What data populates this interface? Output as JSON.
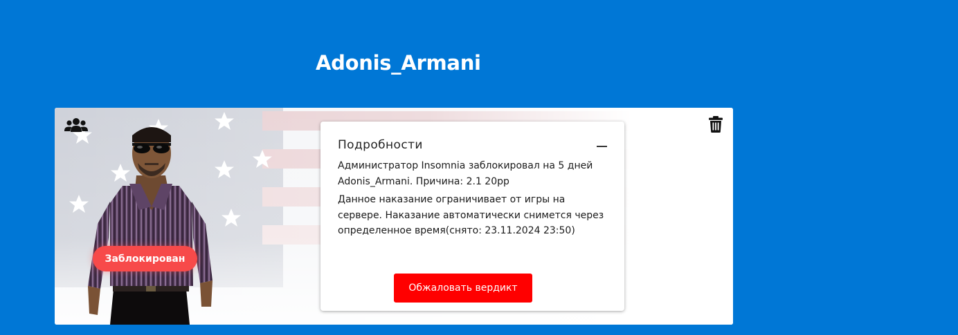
{
  "profile": {
    "username": "Adonis_Armani",
    "status_badge": "Заблокирован"
  },
  "card": {
    "players_icon": "users-group-icon",
    "delete_icon": "trash-icon",
    "background_image": "american-flag"
  },
  "details": {
    "title": "Подробности",
    "collapse_icon": "minus-icon",
    "ban_message": "Администратор Insomnia заблокировал на 5 дней Adonis_Armani. Причина: 2.1 20pp",
    "info_message": "Данное наказание ограничивает от игры на сервере. Наказание автоматически снимется через определенное время(снято: 23.11.2024 23:50)",
    "appeal_button": "Обжаловать вердикт"
  },
  "colors": {
    "page_background": "#0077d6",
    "badge": "#f74a4a",
    "appeal_button": "#ff0000"
  }
}
